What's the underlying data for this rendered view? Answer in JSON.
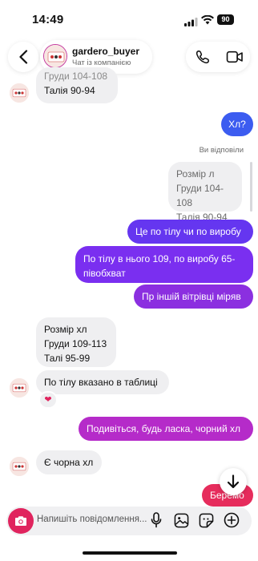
{
  "status_bar": {
    "time": "14:49",
    "battery": "90"
  },
  "header": {
    "username": "gardero_buyer",
    "subtitle": "Чат із компанією"
  },
  "messages": {
    "m1_line1": "Груди 104-108",
    "m1_line2": "Талія 90-94",
    "m2": "Хл?",
    "replied_label": "Ви відповіли",
    "quoted_line1": "Розмір л",
    "quoted_line2": "Груди 104-108",
    "quoted_line3": "Талія 90-94",
    "m3": "Це по тілу чи по виробу",
    "m4_line1": "По тілу в нього 109, по виробу 65-",
    "m4_line2": "півобхват",
    "m5": "Пр іншій вітрівці міряв",
    "m6_line1": "Розмір хл",
    "m6_line2": "Груди 109-113",
    "m6_line3": "Талі 95-99",
    "m7": "По тілу вказано в таблиці",
    "m7_reaction": "❤",
    "m8": "Подивіться, будь ласка, чорний хл",
    "m9": "Є чорна хл",
    "m10": "Беремо"
  },
  "composer": {
    "placeholder": "Напишіть повідомлення..."
  },
  "colors": {
    "blue_out": "#3c5cf0",
    "violet_out": "#7a2ff0",
    "purple_out": "#8b2fe0",
    "magenta_out": "#b52bc9",
    "red_out": "#e62c5c",
    "incoming": "#efeff1",
    "camera": "#e0245e"
  }
}
